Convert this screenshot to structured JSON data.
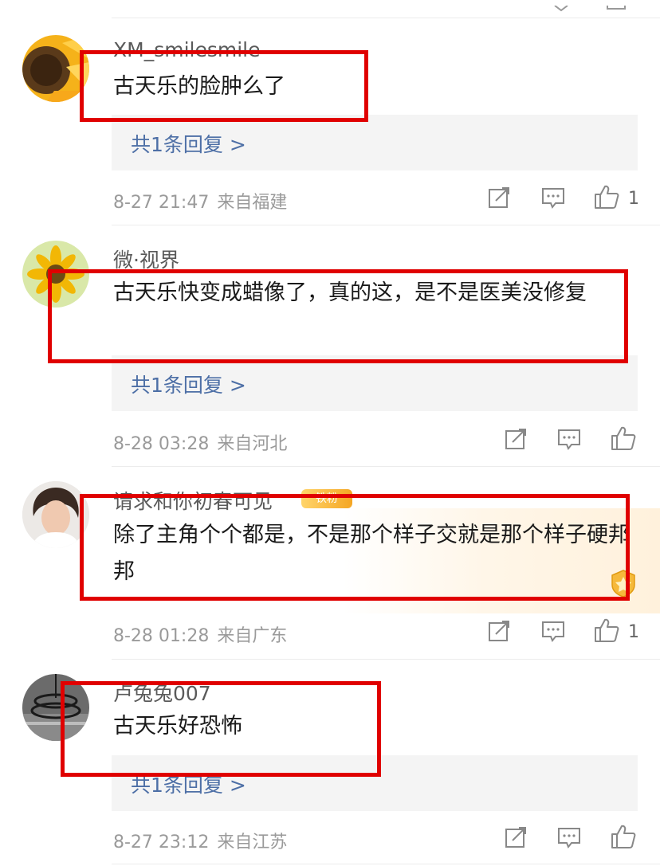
{
  "comments": [
    {
      "username": "XM_smilesmile",
      "text": "古天乐的脸肿么了",
      "reply_label": "共1条回复 >",
      "time": "8-27 21:47",
      "location": "来自福建",
      "likes": "1"
    },
    {
      "username": "微·视界",
      "text": "古天乐快变成蜡像了，真的这，是不是医美没修复",
      "reply_label": "共1条回复 >",
      "time": "8-28 03:28",
      "location": "来自河北",
      "likes": ""
    },
    {
      "username": "请求和你初春可见",
      "badge": "铁粉",
      "text": "除了主角个个都是，不是那个样子交就是那个样子硬邦邦",
      "time": "8-28 01:28",
      "location": "来自广东",
      "likes": "1"
    },
    {
      "username": "卢兔兔007",
      "text": "古天乐好恐怖",
      "reply_label": "共1条回复 >",
      "time": "8-27 23:12",
      "location": "来自江苏",
      "likes": ""
    }
  ],
  "icons": {
    "share": "share-icon",
    "comment": "comment-icon",
    "like": "thumbs-up-icon"
  },
  "colors": {
    "highlight_box": "#e00000",
    "reply_link": "#4d6fa6",
    "meta_text": "#9a9a9a",
    "reply_background": "#f4f4f4"
  }
}
